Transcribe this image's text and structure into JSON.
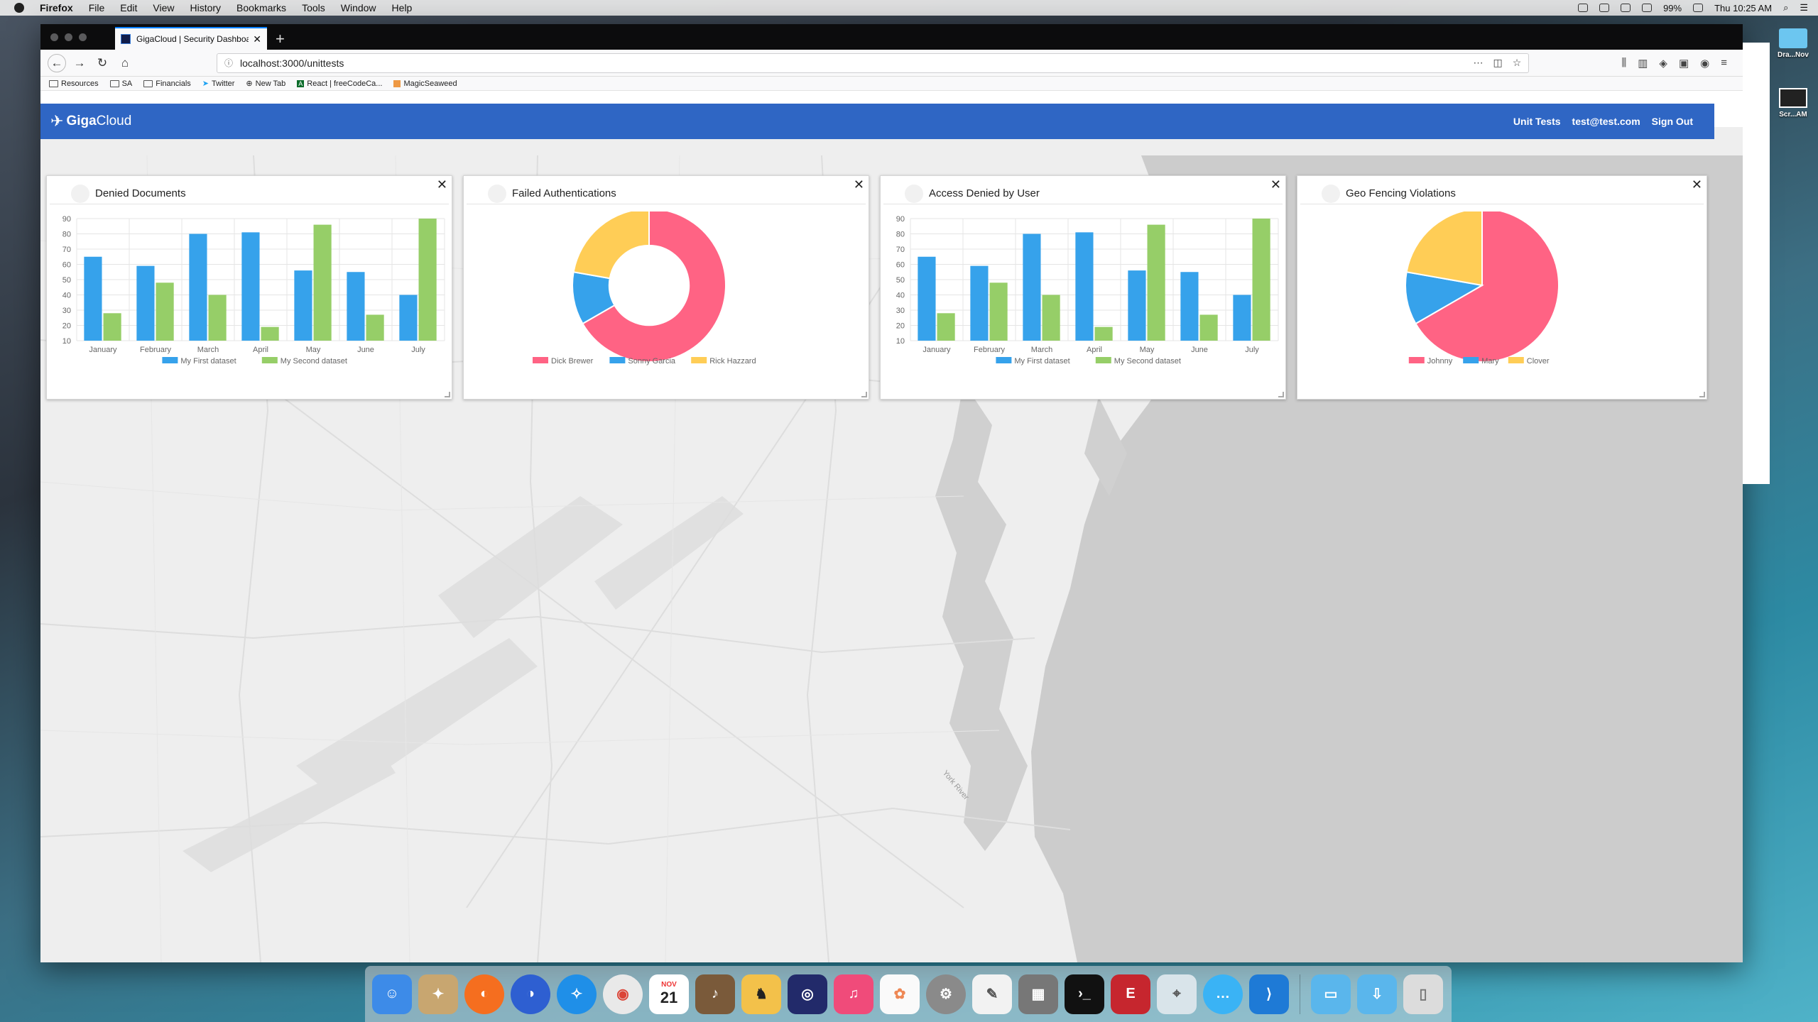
{
  "menubar": {
    "app": "Firefox",
    "items": [
      "File",
      "Edit",
      "View",
      "History",
      "Bookmarks",
      "Tools",
      "Window",
      "Help"
    ],
    "battery": "99%",
    "clock": "Thu 10:25 AM"
  },
  "browser": {
    "tab_title": "GigaCloud | Security Dashboard",
    "tab_close": "✕",
    "new_tab": "+",
    "url": "localhost:3000/unittests",
    "bookmarks": [
      "Resources",
      "SA",
      "Financials",
      "Twitter",
      "New Tab",
      "React | freeCodeCa...",
      "MagicSeaweed"
    ]
  },
  "app": {
    "logo_giga": "Giga",
    "logo_cloud": "Cloud",
    "nav": {
      "unit_tests": "Unit Tests",
      "email": "test@test.com",
      "sign_out": "Sign Out"
    }
  },
  "panels": {
    "close": "✕",
    "denied_documents": {
      "title": "Denied Documents"
    },
    "failed_auth": {
      "title": "Failed Authentications"
    },
    "access_denied": {
      "title": "Access Denied by User"
    },
    "geo_fencing": {
      "title": "Geo Fencing Violations"
    }
  },
  "map": {
    "label": "York River"
  },
  "desktop": {
    "item1": "Dra...Nov",
    "item2": "Scr...AM"
  },
  "dock": {
    "calendar_month": "NOV",
    "calendar_day": "21"
  },
  "colors": {
    "blue": "#36a2eb",
    "green": "#96ce68",
    "pink": "#ff6384",
    "yellow": "#ffcd56",
    "header": "#2f66c4"
  },
  "chart_data": [
    {
      "id": "denied_documents",
      "type": "bar",
      "categories": [
        "January",
        "February",
        "March",
        "April",
        "May",
        "June",
        "July"
      ],
      "series": [
        {
          "name": "My First dataset",
          "values": [
            65,
            59,
            80,
            81,
            56,
            55,
            40
          ]
        },
        {
          "name": "My Second dataset",
          "values": [
            28,
            48,
            40,
            19,
            86,
            27,
            90
          ]
        }
      ],
      "yticks": [
        10,
        20,
        30,
        40,
        50,
        60,
        70,
        80,
        90
      ],
      "ylim": [
        10,
        90
      ],
      "grid": true,
      "legend": "bottom"
    },
    {
      "id": "failed_auth",
      "type": "doughnut",
      "labels": [
        "Dick Brewer",
        "Sonny Garcia",
        "Rick Hazzard"
      ],
      "values": [
        300,
        50,
        100
      ],
      "legend": "bottom"
    },
    {
      "id": "access_denied",
      "type": "bar",
      "categories": [
        "January",
        "February",
        "March",
        "April",
        "May",
        "June",
        "July"
      ],
      "series": [
        {
          "name": "My First dataset",
          "values": [
            65,
            59,
            80,
            81,
            56,
            55,
            40
          ]
        },
        {
          "name": "My Second dataset",
          "values": [
            28,
            48,
            40,
            19,
            86,
            27,
            90
          ]
        }
      ],
      "yticks": [
        10,
        20,
        30,
        40,
        50,
        60,
        70,
        80,
        90
      ],
      "ylim": [
        10,
        90
      ],
      "grid": true,
      "legend": "bottom"
    },
    {
      "id": "geo_fencing",
      "type": "pie",
      "labels": [
        "Johnny",
        "Mary",
        "Clover"
      ],
      "values": [
        300,
        50,
        100
      ],
      "legend": "bottom"
    }
  ]
}
